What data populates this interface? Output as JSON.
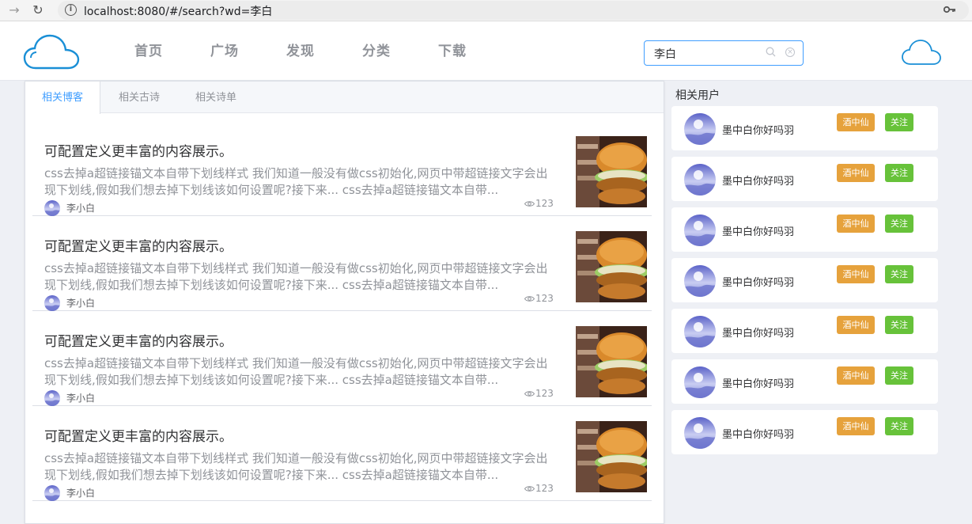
{
  "browser": {
    "url": "localhost:8080/#/search?wd=李白",
    "back_icon": "arrow-forward-icon",
    "reload_icon": "reload-icon"
  },
  "header": {
    "menu": [
      {
        "label": "首页"
      },
      {
        "label": "广场"
      },
      {
        "label": "发现"
      },
      {
        "label": "分类"
      },
      {
        "label": "下载"
      }
    ],
    "search_value": "李白",
    "accent_color": "#409eff"
  },
  "tabs": [
    {
      "label": "相关博客",
      "active": true
    },
    {
      "label": "相关古诗",
      "active": false
    },
    {
      "label": "相关诗单",
      "active": false
    }
  ],
  "blogs": [
    {
      "title": "可配置定义更丰富的内容展示。",
      "desc": "css去掉a超链接锚文本自带下划线样式 我们知道一般没有做css初始化,网页中带超链接文字会出现下划线,假如我们想去掉下划线该如何设置呢?接下来... css去掉a超链接锚文本自带...",
      "author": "李小白",
      "views": "123"
    },
    {
      "title": "可配置定义更丰富的内容展示。",
      "desc": "css去掉a超链接锚文本自带下划线样式 我们知道一般没有做css初始化,网页中带超链接文字会出现下划线,假如我们想去掉下划线该如何设置呢?接下来... css去掉a超链接锚文本自带...",
      "author": "李小白",
      "views": "123"
    },
    {
      "title": "可配置定义更丰富的内容展示。",
      "desc": "css去掉a超链接锚文本自带下划线样式 我们知道一般没有做css初始化,网页中带超链接文字会出现下划线,假如我们想去掉下划线该如何设置呢?接下来... css去掉a超链接锚文本自带...",
      "author": "李小白",
      "views": "123"
    },
    {
      "title": "可配置定义更丰富的内容展示。",
      "desc": "css去掉a超链接锚文本自带下划线样式 我们知道一般没有做css初始化,网页中带超链接文字会出现下划线,假如我们想去掉下划线该如何设置呢?接下来... css去掉a超链接锚文本自带...",
      "author": "李小白",
      "views": "123"
    }
  ],
  "users_title": "相关用户",
  "users": [
    {
      "name": "墨中白你好吗羽",
      "tag": "酒中仙",
      "follow": "关注"
    },
    {
      "name": "墨中白你好吗羽",
      "tag": "酒中仙",
      "follow": "关注"
    },
    {
      "name": "墨中白你好吗羽",
      "tag": "酒中仙",
      "follow": "关注"
    },
    {
      "name": "墨中白你好吗羽",
      "tag": "酒中仙",
      "follow": "关注"
    },
    {
      "name": "墨中白你好吗羽",
      "tag": "酒中仙",
      "follow": "关注"
    },
    {
      "name": "墨中白你好吗羽",
      "tag": "酒中仙",
      "follow": "关注"
    },
    {
      "name": "墨中白你好吗羽",
      "tag": "酒中仙",
      "follow": "关注"
    }
  ],
  "colors": {
    "tag": "#e6a23c",
    "follow": "#67c23a",
    "logo": "#1a8fd6"
  }
}
